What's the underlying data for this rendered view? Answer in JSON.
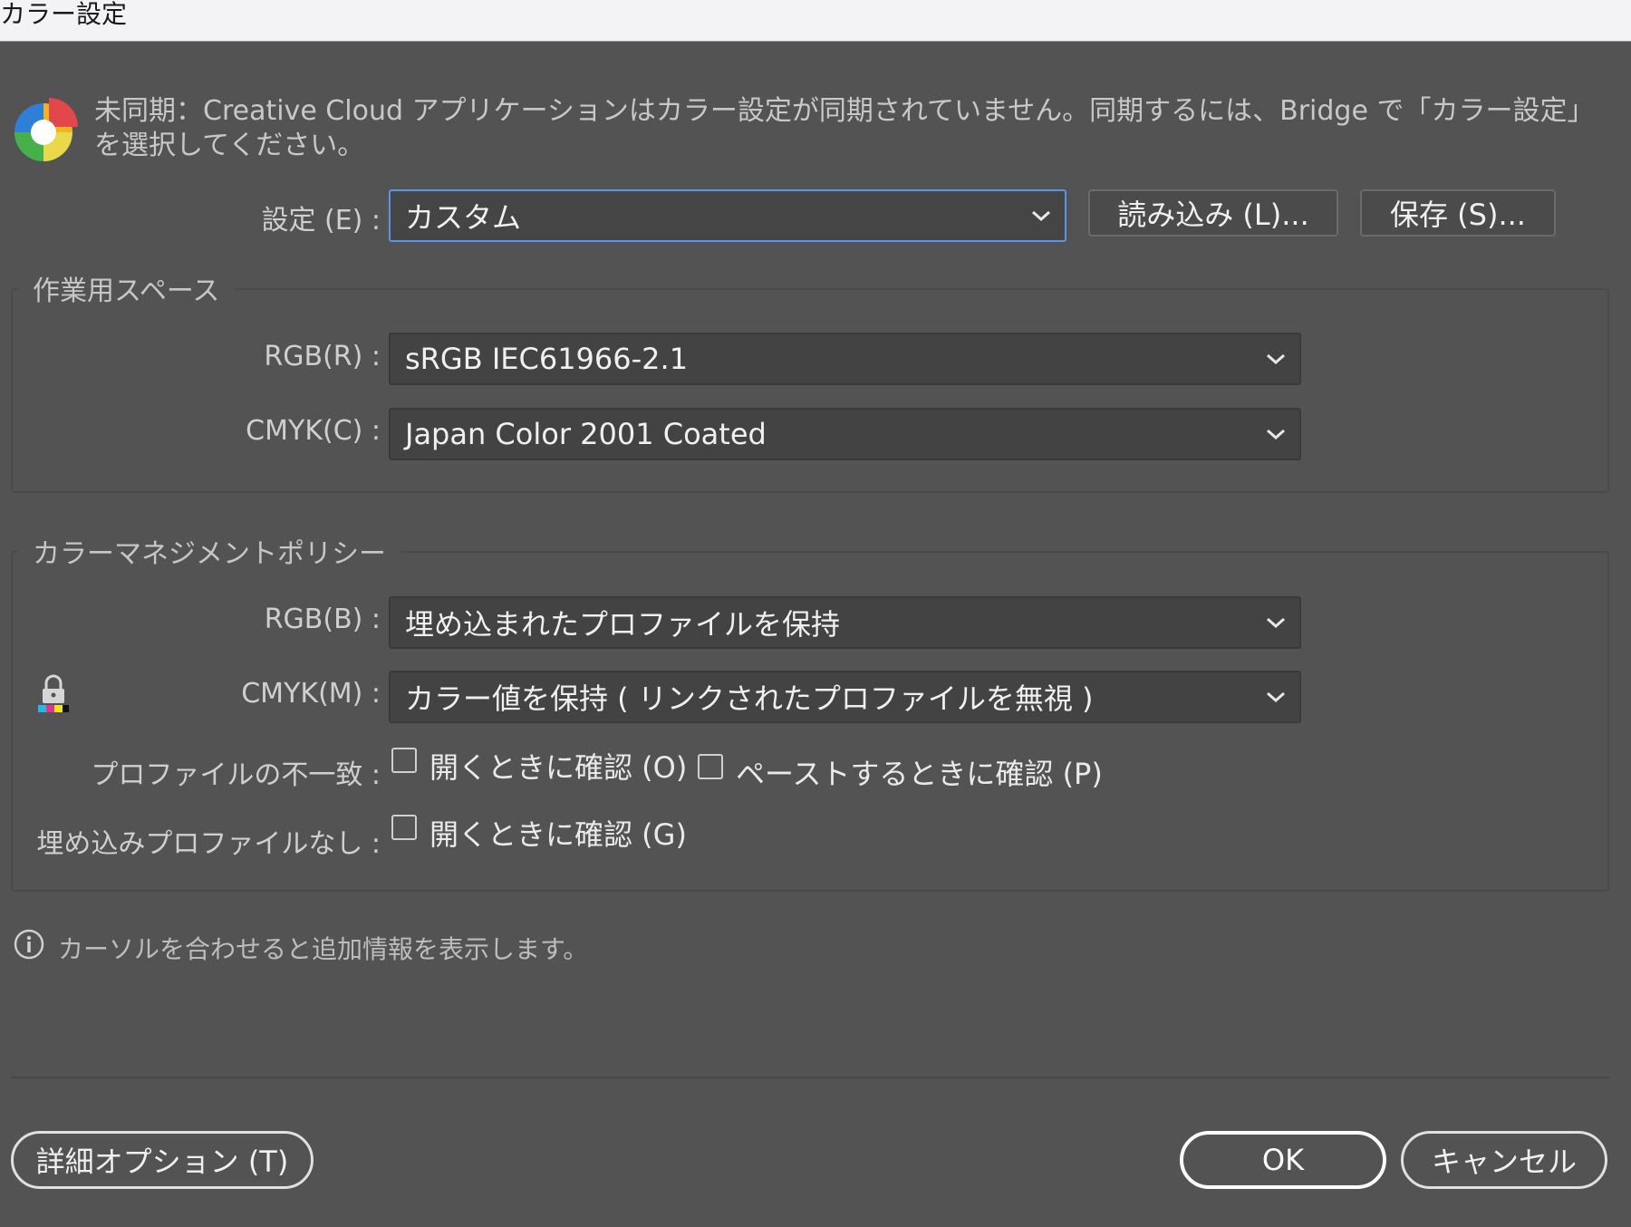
{
  "window": {
    "title": "カラー設定"
  },
  "notice": {
    "text": "未同期：Creative Cloud アプリケーションはカラー設定が同期されていません。同期するには、Bridge で「カラー設定」\nを選択してください。"
  },
  "settings": {
    "label": "設定 (E) :",
    "value": "カスタム",
    "load_button": "読み込み (L)...",
    "save_button": "保存 (S)..."
  },
  "working_spaces": {
    "title": "作業用スペース",
    "rgb_label": "RGB(R) :",
    "rgb_value": "sRGB IEC61966-2.1",
    "cmyk_label": "CMYK(C) :",
    "cmyk_value": "Japan Color 2001 Coated"
  },
  "policies": {
    "title": "カラーマネジメントポリシー",
    "rgb_label": "RGB(B) :",
    "rgb_value": "埋め込まれたプロファイルを保持",
    "cmyk_label": "CMYK(M) :",
    "cmyk_value": "カラー値を保持 ( リンクされたプロファイルを無視 )",
    "mismatch_label": "プロファイルの不一致 :",
    "mismatch_open": "開くときに確認 (O)",
    "mismatch_paste": "ペーストするときに確認 (P)",
    "missing_label": "埋め込みプロファイルなし :",
    "missing_open": "開くときに確認 (G)"
  },
  "info": {
    "text": "カーソルを合わせると追加情報を表示します。"
  },
  "footer": {
    "advanced_button": "詳細オプション (T)",
    "ok_button": "OK",
    "cancel_button": "キャンセル"
  },
  "colors": {
    "accent": "#5b93e6",
    "background": "#535353",
    "field": "#434343"
  }
}
